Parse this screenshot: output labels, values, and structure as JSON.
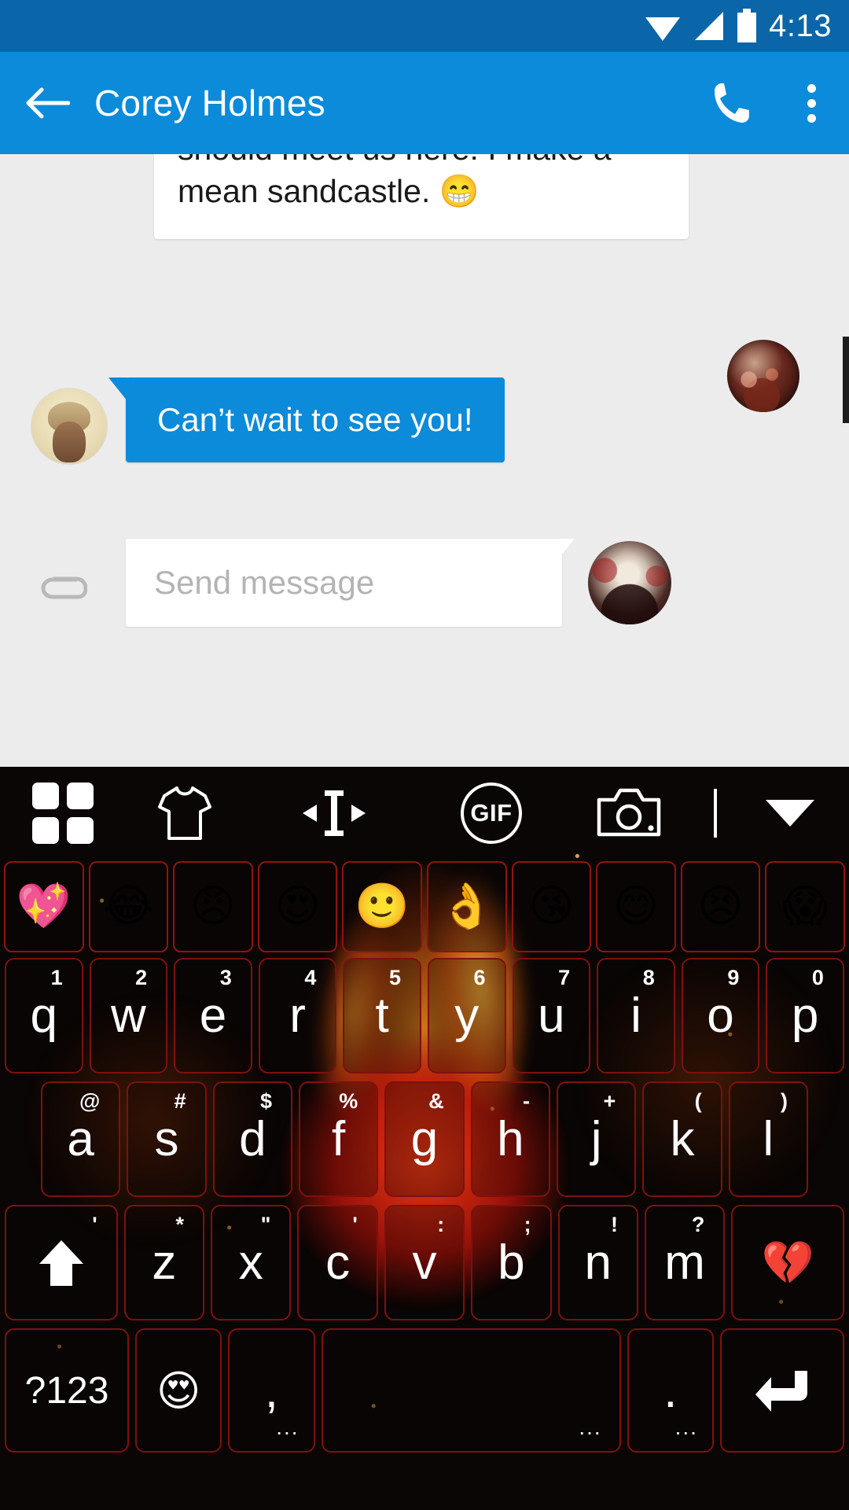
{
  "statusbar": {
    "time": "4:13",
    "icons": [
      "wifi-icon",
      "signal-icon",
      "battery-icon"
    ]
  },
  "appbar": {
    "title": "Corey Holmes",
    "back_icon": "back-arrow-icon",
    "call_icon": "phone-icon",
    "overflow_icon": "more-vertical-icon",
    "background": "#0b8bd9"
  },
  "chat": {
    "messages": [
      {
        "type": "incoming",
        "text": "should meet us here! I make a mean sandcastle. 😁",
        "avatar": "contact-avatar"
      },
      {
        "type": "outgoing",
        "text": "Can’t wait to see you!",
        "avatar": "sender-avatar"
      }
    ]
  },
  "compose": {
    "attach_icon": "paperclip-icon",
    "placeholder": "Send message",
    "value": "",
    "avatar": "dog-avatar"
  },
  "keyboard": {
    "toolbar": [
      {
        "name": "apps-grid-icon",
        "label": ""
      },
      {
        "name": "tshirt-theme-icon",
        "label": ""
      },
      {
        "name": "cursor-move-icon",
        "label": ""
      },
      {
        "name": "gif-icon",
        "label": "GIF"
      },
      {
        "name": "camera-icon",
        "label": ""
      },
      {
        "name": "divider",
        "label": ""
      },
      {
        "name": "collapse-keyboard-icon",
        "label": ""
      }
    ],
    "emoji_row": [
      "💖",
      "😂",
      "😠",
      "😍",
      "🙂",
      "👌",
      "😘",
      "😊",
      "😣",
      "😱"
    ],
    "row1": [
      {
        "key": "q",
        "sup": "1"
      },
      {
        "key": "w",
        "sup": "2"
      },
      {
        "key": "e",
        "sup": "3"
      },
      {
        "key": "r",
        "sup": "4"
      },
      {
        "key": "t",
        "sup": "5"
      },
      {
        "key": "y",
        "sup": "6"
      },
      {
        "key": "u",
        "sup": "7"
      },
      {
        "key": "i",
        "sup": "8"
      },
      {
        "key": "o",
        "sup": "9"
      },
      {
        "key": "p",
        "sup": "0"
      }
    ],
    "row2": [
      {
        "key": "a",
        "sup": "@"
      },
      {
        "key": "s",
        "sup": "#"
      },
      {
        "key": "d",
        "sup": "$"
      },
      {
        "key": "f",
        "sup": "%"
      },
      {
        "key": "g",
        "sup": "&"
      },
      {
        "key": "h",
        "sup": "-"
      },
      {
        "key": "j",
        "sup": "+"
      },
      {
        "key": "k",
        "sup": "("
      },
      {
        "key": "l",
        "sup": ")"
      }
    ],
    "row3": {
      "shift": {
        "name": "shift-key",
        "sup": "'"
      },
      "letters": [
        {
          "key": "z",
          "sup": "*"
        },
        {
          "key": "x",
          "sup": "\""
        },
        {
          "key": "c",
          "sup": "'"
        },
        {
          "key": "v",
          "sup": ":"
        },
        {
          "key": "b",
          "sup": ";"
        },
        {
          "key": "n",
          "sup": "!"
        },
        {
          "key": "m",
          "sup": "?"
        }
      ],
      "backspace": {
        "name": "backspace-key",
        "glyph": "💔"
      }
    },
    "row4": {
      "symbols": "?123",
      "emoji_key": "😍",
      "comma": ",",
      "comma_sub": "...",
      "space": "",
      "space_sub": "...",
      "period": ".",
      "period_sub": "...",
      "enter": "enter-key"
    },
    "theme_colors": {
      "key_border": "#7e110e",
      "background": "#0a0605",
      "text": "#ffffff"
    }
  }
}
